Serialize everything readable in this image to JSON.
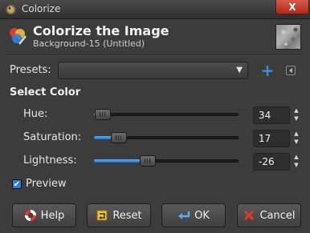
{
  "window": {
    "title": "Colorize",
    "close_label": "X"
  },
  "header": {
    "title": "Colorize the Image",
    "subtitle": "Background-15 (Untitled)"
  },
  "presets": {
    "label": "Presets:",
    "value": "",
    "add_icon": "plus-icon",
    "menu_icon": "triangle-menu-icon"
  },
  "select_color": {
    "title": "Select Color",
    "hue": {
      "label": "Hue:",
      "value": "34",
      "level": 0.06
    },
    "saturation": {
      "label": "Saturation:",
      "value": "17",
      "level": 0.17
    },
    "lightness": {
      "label": "Lightness:",
      "value": "-26",
      "level": 0.37
    }
  },
  "preview": {
    "label": "Preview",
    "checked": true
  },
  "buttons": {
    "help": "Help",
    "reset": "Reset",
    "ok": "OK",
    "cancel": "Cancel"
  },
  "colors": {
    "accent": "#2a7ee0",
    "background": "#3c3c3c"
  }
}
